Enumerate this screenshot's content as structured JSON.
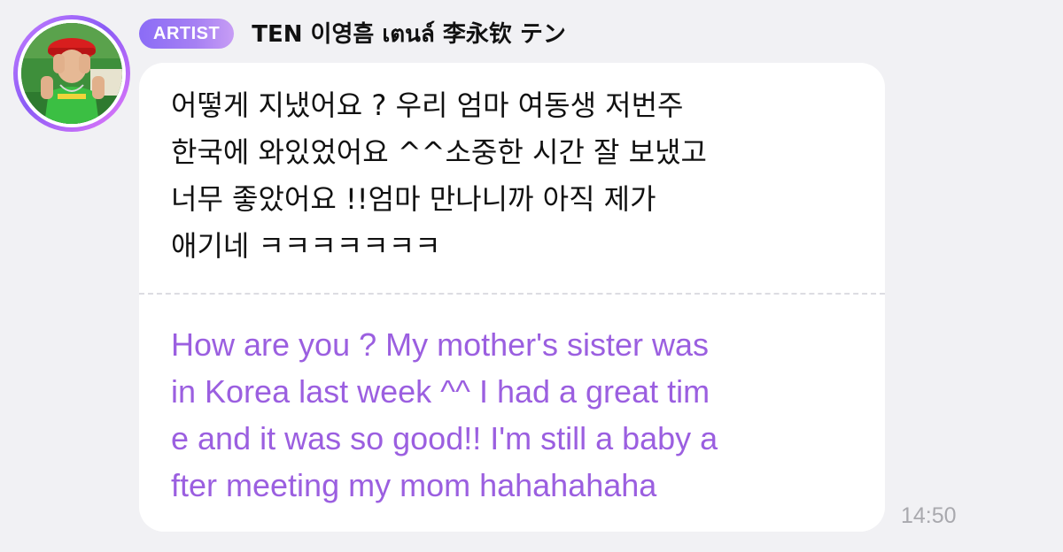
{
  "header": {
    "badge_label": "ARTIST",
    "artist_name": "TEN 이영흠 เตนล์ 李永钦 テン"
  },
  "message": {
    "original_lines": [
      "어떻게 지냈어요 ? 우리 엄마 여동생 저번주",
      "한국에 와있었어요 ^^소중한 시간 잘 보냈고",
      "너무 좋았어요 !!엄마 만나니까 아직 제가",
      "애기네 ㅋㅋㅋㅋㅋㅋㅋ"
    ],
    "translation_lines": [
      "How are you ? My mother's sister was",
      "in Korea last week ^^ I had a great tim",
      "e and it was so good!! I'm still a baby a",
      "fter meeting my mom hahahahaha"
    ],
    "timestamp": "14:50"
  },
  "colors": {
    "badge_gradient_start": "#8b6cf6",
    "translation_text": "#9b5fe0",
    "avatar_ring": "#a66bff",
    "background": "#f1f1f4",
    "bubble": "#ffffff"
  },
  "icons": {
    "avatar": "artist-avatar"
  }
}
